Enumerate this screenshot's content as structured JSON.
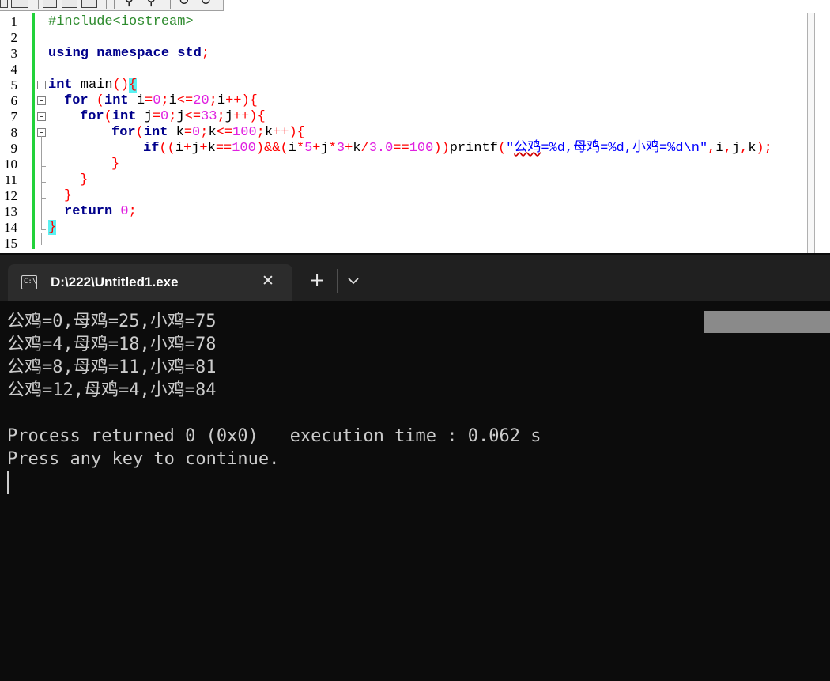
{
  "editor": {
    "line_numbers": [
      "1",
      "2",
      "3",
      "4",
      "5",
      "6",
      "7",
      "8",
      "9",
      "10",
      "11",
      "12",
      "13",
      "14",
      "15"
    ],
    "code": {
      "l1": "#include<iostream>",
      "l3_kw1": "using",
      "l3_kw2": "namespace",
      "l3_kw3": "std",
      "l3_end": ";",
      "l5_kw": "int",
      "l5_fn": " main",
      "l5_paren": "()",
      "l5_brace": "{",
      "l6_kw": "for",
      "l6_a": " (",
      "l6_kw2": "int",
      "l6_b": " i",
      "l6_c": "=",
      "l6_d": "0",
      "l6_e": ";",
      "l6_f": "i",
      "l6_g": "<=",
      "l6_h": "20",
      "l6_i": ";",
      "l6_j": "i",
      "l6_k": "++){",
      "l7_kw": "for",
      "l7_a": "(",
      "l7_kw2": "int",
      "l7_b": " j",
      "l7_c": "=",
      "l7_d": "0",
      "l7_e": ";",
      "l7_f": "j",
      "l7_g": "<=",
      "l7_h": "33",
      "l7_i": ";",
      "l7_j": "j",
      "l7_k": "++){",
      "l8_kw": "for",
      "l8_a": "(",
      "l8_kw2": "int",
      "l8_b": " k",
      "l8_c": "=",
      "l8_d": "0",
      "l8_e": ";",
      "l8_f": "k",
      "l8_g": "<=",
      "l8_h": "100",
      "l8_i": ";",
      "l8_j": "k",
      "l8_k": "++){",
      "l9_kw": "if",
      "l9_a": "((",
      "l9_b": "i",
      "l9_c": "+",
      "l9_d": "j",
      "l9_e": "+",
      "l9_f": "k",
      "l9_g": "==",
      "l9_h": "100",
      "l9_i": ")&&(",
      "l9_j": "i",
      "l9_k": "*",
      "l9_l": "5",
      "l9_m": "+",
      "l9_n": "j",
      "l9_o": "*",
      "l9_p": "3",
      "l9_q": "+",
      "l9_r": "k",
      "l9_s": "/",
      "l9_t": "3.0",
      "l9_u": "==",
      "l9_v": "100",
      "l9_w": "))",
      "l9_x": "printf",
      "l9_y": "(",
      "l9_s1": "\"",
      "l9_s2": "公鸡",
      "l9_s3": "=%d,母鸡=%d,小鸡=%d\\n\"",
      "l9_z": ",",
      "l9_aa": "i",
      "l9_ab": ",",
      "l9_ac": "j",
      "l9_ad": ",",
      "l9_ae": "k",
      "l9_af": ");",
      "l10": "}",
      "l11": "}",
      "l12": "}",
      "l13_kw": "return",
      "l13_num": "0",
      "l13_end": ";",
      "l14": "}"
    }
  },
  "terminal": {
    "tab_title": "D:\\222\\Untitled1.exe",
    "tab_icon_text": "C:\\",
    "close_symbol": "✕",
    "new_tab_symbol": "+",
    "output": [
      "公鸡=0,母鸡=25,小鸡=75",
      "公鸡=4,母鸡=18,小鸡=78",
      "公鸡=8,母鸡=11,小鸡=81",
      "公鸡=12,母鸡=4,小鸡=84",
      "",
      "Process returned 0 (0x0)   execution time : 0.062 s",
      "Press any key to continue."
    ]
  }
}
